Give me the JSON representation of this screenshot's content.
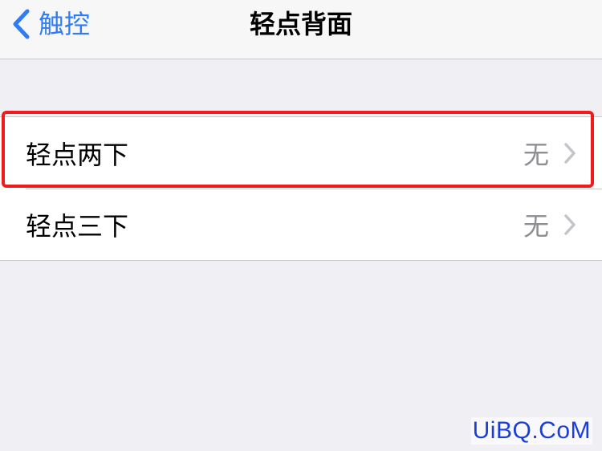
{
  "navbar": {
    "back_label": "触控",
    "title": "轻点背面",
    "back_icon": "chevron-left-icon"
  },
  "settings": {
    "rows": [
      {
        "label": "轻点两下",
        "value": "无",
        "icon": "chevron-right-icon",
        "highlighted": true
      },
      {
        "label": "轻点三下",
        "value": "无",
        "icon": "chevron-right-icon",
        "highlighted": false
      }
    ]
  },
  "watermark": {
    "text": "UiBQ.CoM"
  },
  "colors": {
    "accent": "#2f7cf6",
    "highlight": "#ee1c1c",
    "background": "#efeff4",
    "secondary_text": "#8e8e93"
  }
}
